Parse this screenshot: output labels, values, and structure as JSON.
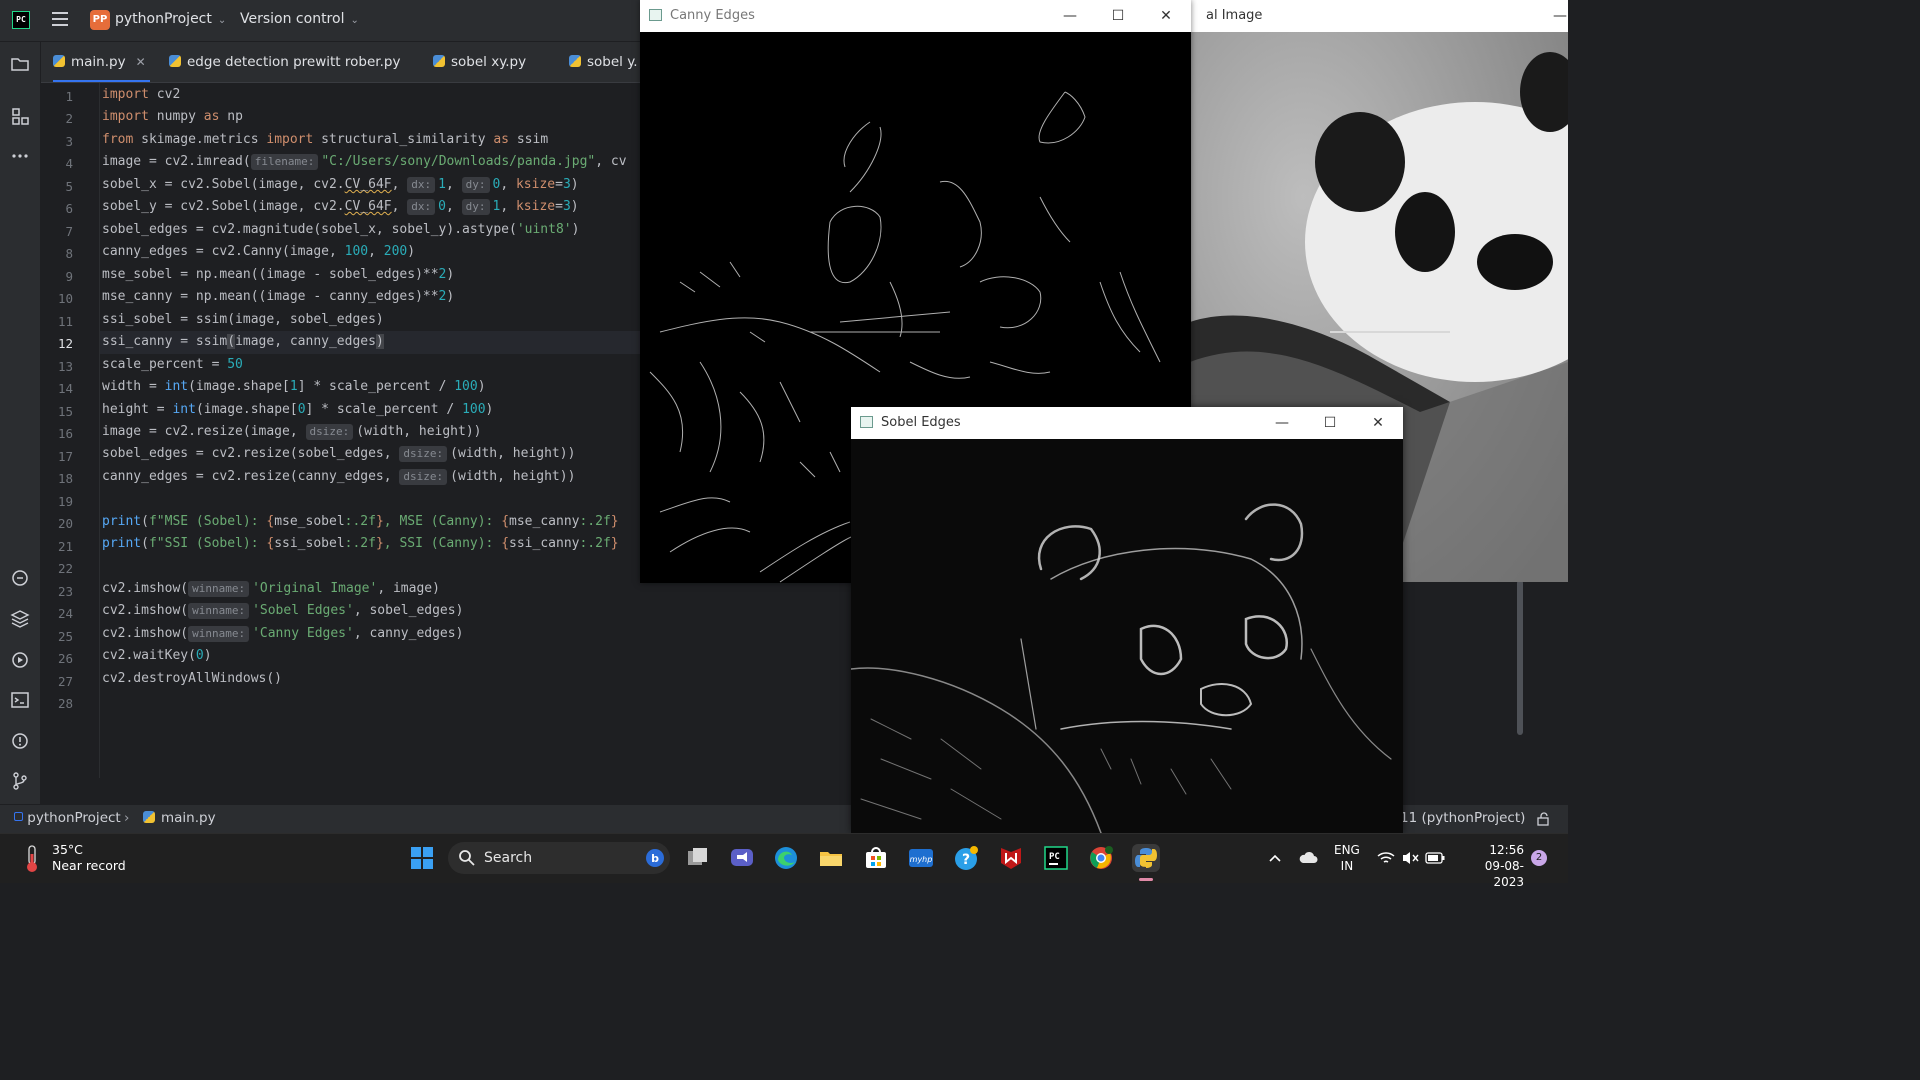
{
  "ide": {
    "logo_text": "PC",
    "project_badge": "PP",
    "project_name": "pythonProject",
    "version_control": "Version control",
    "tabs": [
      {
        "label": "main.py",
        "active": true
      },
      {
        "label": "edge detection prewitt rober.py"
      },
      {
        "label": "sobel xy.py"
      },
      {
        "label": "sobel y."
      }
    ],
    "current_line": 12,
    "line_numbers": [
      "1",
      "2",
      "3",
      "4",
      "5",
      "6",
      "7",
      "8",
      "9",
      "10",
      "11",
      "12",
      "13",
      "14",
      "15",
      "16",
      "17",
      "18",
      "19",
      "20",
      "21",
      "22",
      "23",
      "24",
      "25",
      "26",
      "27",
      "28"
    ],
    "code": {
      "l1_kw": "import",
      "l1_rest": " cv2",
      "l2_kw": "import",
      "l2_mid": " numpy ",
      "l2_as": "as",
      "l2_rest": " np",
      "l3_from": "from",
      "l3_mod": " skimage.metrics ",
      "l3_imp": "import",
      "l3_name": " structural_similarity ",
      "l3_as": "as",
      "l3_rest": " ssim",
      "l4_a": "image = cv2.imread(",
      "l4_hint": "filename:",
      "l4_str": "\"C:/Users/sony/Downloads/panda.jpg\"",
      "l4_b": ", cv",
      "l5_a": "sobel_x = cv2.Sobel(image, cv2.",
      "l5_cv": "CV_64F",
      "l5_b": ", ",
      "l5_h1": "dx:",
      "l5_n1": "1",
      "l5_c": ", ",
      "l5_h2": "dy:",
      "l5_n2": "0",
      "l5_d": ", ",
      "l5_k": "ksize",
      "l5_e": "=",
      "l5_n3": "3",
      "l5_f": ")",
      "l6_a": "sobel_y = cv2.Sobel(image, cv2.",
      "l6_cv": "CV_64F",
      "l6_b": ", ",
      "l6_h1": "dx:",
      "l6_n1": "0",
      "l6_c": ", ",
      "l6_h2": "dy:",
      "l6_n2": "1",
      "l6_d": ", ",
      "l6_k": "ksize",
      "l6_e": "=",
      "l6_n3": "3",
      "l6_f": ")",
      "l7_a": "sobel_edges = cv2.magnitude(sobel_x, sobel_y).astype(",
      "l7_str": "'uint8'",
      "l7_b": ")",
      "l8_a": "canny_edges = cv2.Canny(image, ",
      "l8_n1": "100",
      "l8_b": ", ",
      "l8_n2": "200",
      "l8_c": ")",
      "l9_a": "mse_sobel = np.mean((image - sobel_edges)**",
      "l9_n": "2",
      "l9_b": ")",
      "l10_a": "mse_canny = np.mean((image - canny_edges)**",
      "l10_n": "2",
      "l10_b": ")",
      "l11": "ssi_sobel = ssim(image, sobel_edges)",
      "l12_a": "ssi_canny = ssim",
      "l12_p1": "(",
      "l12_b": "image, canny_edges",
      "l12_p2": ")",
      "l13_a": "scale_percent = ",
      "l13_n": "50",
      "l14_a": "width = ",
      "l14_fn": "int",
      "l14_b": "(image.shape[",
      "l14_n1": "1",
      "l14_c": "] * scale_percent / ",
      "l14_n2": "100",
      "l14_d": ")",
      "l15_a": "height = ",
      "l15_fn": "int",
      "l15_b": "(image.shape[",
      "l15_n1": "0",
      "l15_c": "] * scale_percent / ",
      "l15_n2": "100",
      "l15_d": ")",
      "l16_a": "image = cv2.resize(image, ",
      "l16_h": "dsize:",
      "l16_b": "(width, height))",
      "l17_a": "sobel_edges = cv2.resize(sobel_edges, ",
      "l17_h": "dsize:",
      "l17_b": "(width, height))",
      "l18_a": "canny_edges = cv2.resize(canny_edges, ",
      "l18_h": "dsize:",
      "l18_b": "(width, height))",
      "l20_fn": "print",
      "l20_a": "(",
      "l20_s1": "f\"MSE (Sobel): ",
      "l20_b1": "{",
      "l20_v1": "mse_sobel",
      "l20_f1": ":.2f",
      "l20_b2": "}",
      "l20_s2": ", MSE (Canny): ",
      "l20_b3": "{",
      "l20_v2": "mse_canny",
      "l20_f2": ":.2f",
      "l20_b4": "}",
      "l21_fn": "print",
      "l21_a": "(",
      "l21_s1": "f\"SSI (Sobel): ",
      "l21_b1": "{",
      "l21_v1": "ssi_sobel",
      "l21_f1": ":.2f",
      "l21_b2": "}",
      "l21_s2": ", SSI (Canny): ",
      "l21_b3": "{",
      "l21_v2": "ssi_canny",
      "l21_f2": ":.2f",
      "l21_b4": "}",
      "l23_a": "cv2.imshow(",
      "l23_h": "winname:",
      "l23_str": "'Original Image'",
      "l23_b": ", image)",
      "l24_a": "cv2.imshow(",
      "l24_h": "winname:",
      "l24_str": "'Sobel Edges'",
      "l24_b": ", sobel_edges)",
      "l25_a": "cv2.imshow(",
      "l25_h": "winname:",
      "l25_str": "'Canny Edges'",
      "l25_b": ", canny_edges)",
      "l26_a": "cv2.waitKey(",
      "l26_n": "0",
      "l26_b": ")",
      "l27": "cv2.destroyAllWindows()"
    },
    "breadcrumb": {
      "project": "pythonProject",
      "file": "main.py"
    },
    "interpreter": "11 (pythonProject)"
  },
  "windows": {
    "canny": {
      "title": "Canny Edges"
    },
    "original": {
      "title": "al Image"
    },
    "sobel": {
      "title": "Sobel Edges"
    }
  },
  "taskbar": {
    "weather_temp": "35°C",
    "weather_desc": "Near record",
    "search_label": "Search",
    "lang_1": "ENG",
    "lang_2": "IN",
    "time": "12:56",
    "date": "09-08-2023",
    "notification_count": "2"
  },
  "colors": {
    "accent": "#3574f0",
    "keyword": "#cf8e6d",
    "string": "#6aab73",
    "number": "#2aacb8"
  }
}
